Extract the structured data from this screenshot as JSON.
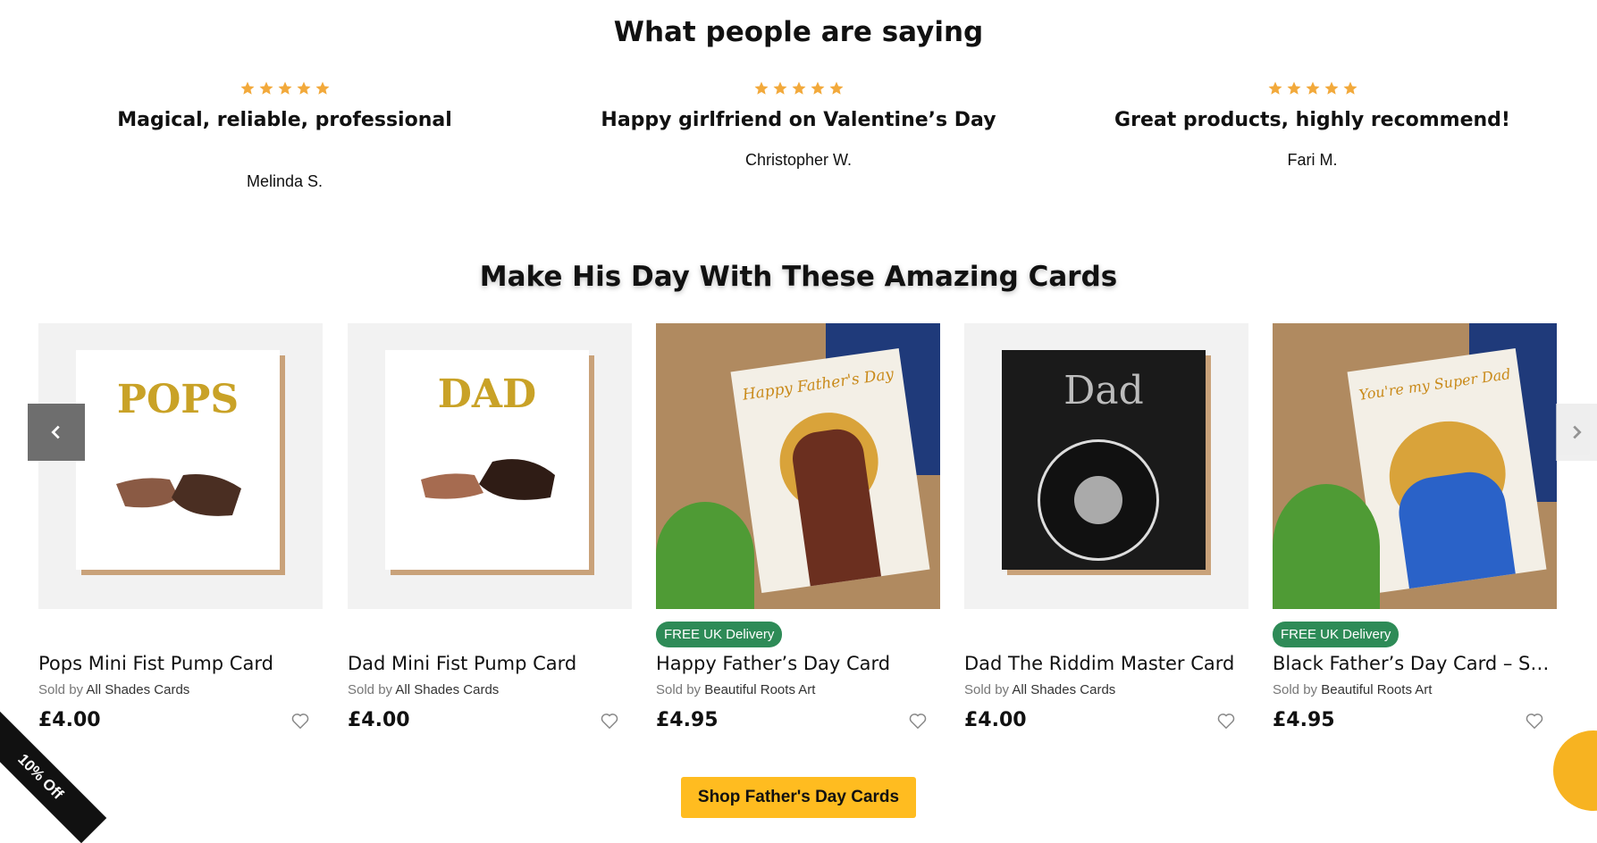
{
  "reviews": {
    "title": "What people are saying",
    "items": [
      {
        "rating": 5,
        "title": "Magical, reliable, professional",
        "author": "Melinda S."
      },
      {
        "rating": 5,
        "title": "Happy girlfriend on Valentine’s Day",
        "author": "Christopher W."
      },
      {
        "rating": 5,
        "title": "Great products, highly recommend!",
        "author": "Fari M."
      }
    ]
  },
  "products": {
    "title": "Make His Day With These Amazing Cards",
    "sold_by_label": "Sold by",
    "items": [
      {
        "name": "Pops Mini Fist Pump Card",
        "seller": "All Shades Cards",
        "price": "£4.00",
        "badge": "",
        "card_text": "POPS"
      },
      {
        "name": "Dad Mini Fist Pump Card",
        "seller": "All Shades Cards",
        "price": "£4.00",
        "badge": "",
        "card_text": "DAD"
      },
      {
        "name": "Happy Father’s Day Card",
        "seller": "Beautiful Roots Art",
        "price": "£4.95",
        "badge": "FREE UK Delivery",
        "card_text": "Happy Father's Day"
      },
      {
        "name": "Dad The Riddim Master Card",
        "seller": "All Shades Cards",
        "price": "£4.00",
        "badge": "",
        "card_text": "Dad"
      },
      {
        "name": "Black Father’s Day Card – Sup...",
        "seller": "Beautiful Roots Art",
        "price": "£4.95",
        "badge": "FREE UK Delivery",
        "card_text": "You're my Super Dad"
      }
    ]
  },
  "cta": {
    "label": "Shop Father's Day Cards"
  },
  "promo": {
    "label": "10% Off"
  },
  "colors": {
    "star": "#f2a93b",
    "badge": "#2e8b57",
    "cta": "#ffbc20"
  },
  "icons": {
    "prev": "chevron-left-icon",
    "next": "chevron-right-icon",
    "wishlist": "heart-outline-icon",
    "chat": "chat-bubble-icon"
  }
}
